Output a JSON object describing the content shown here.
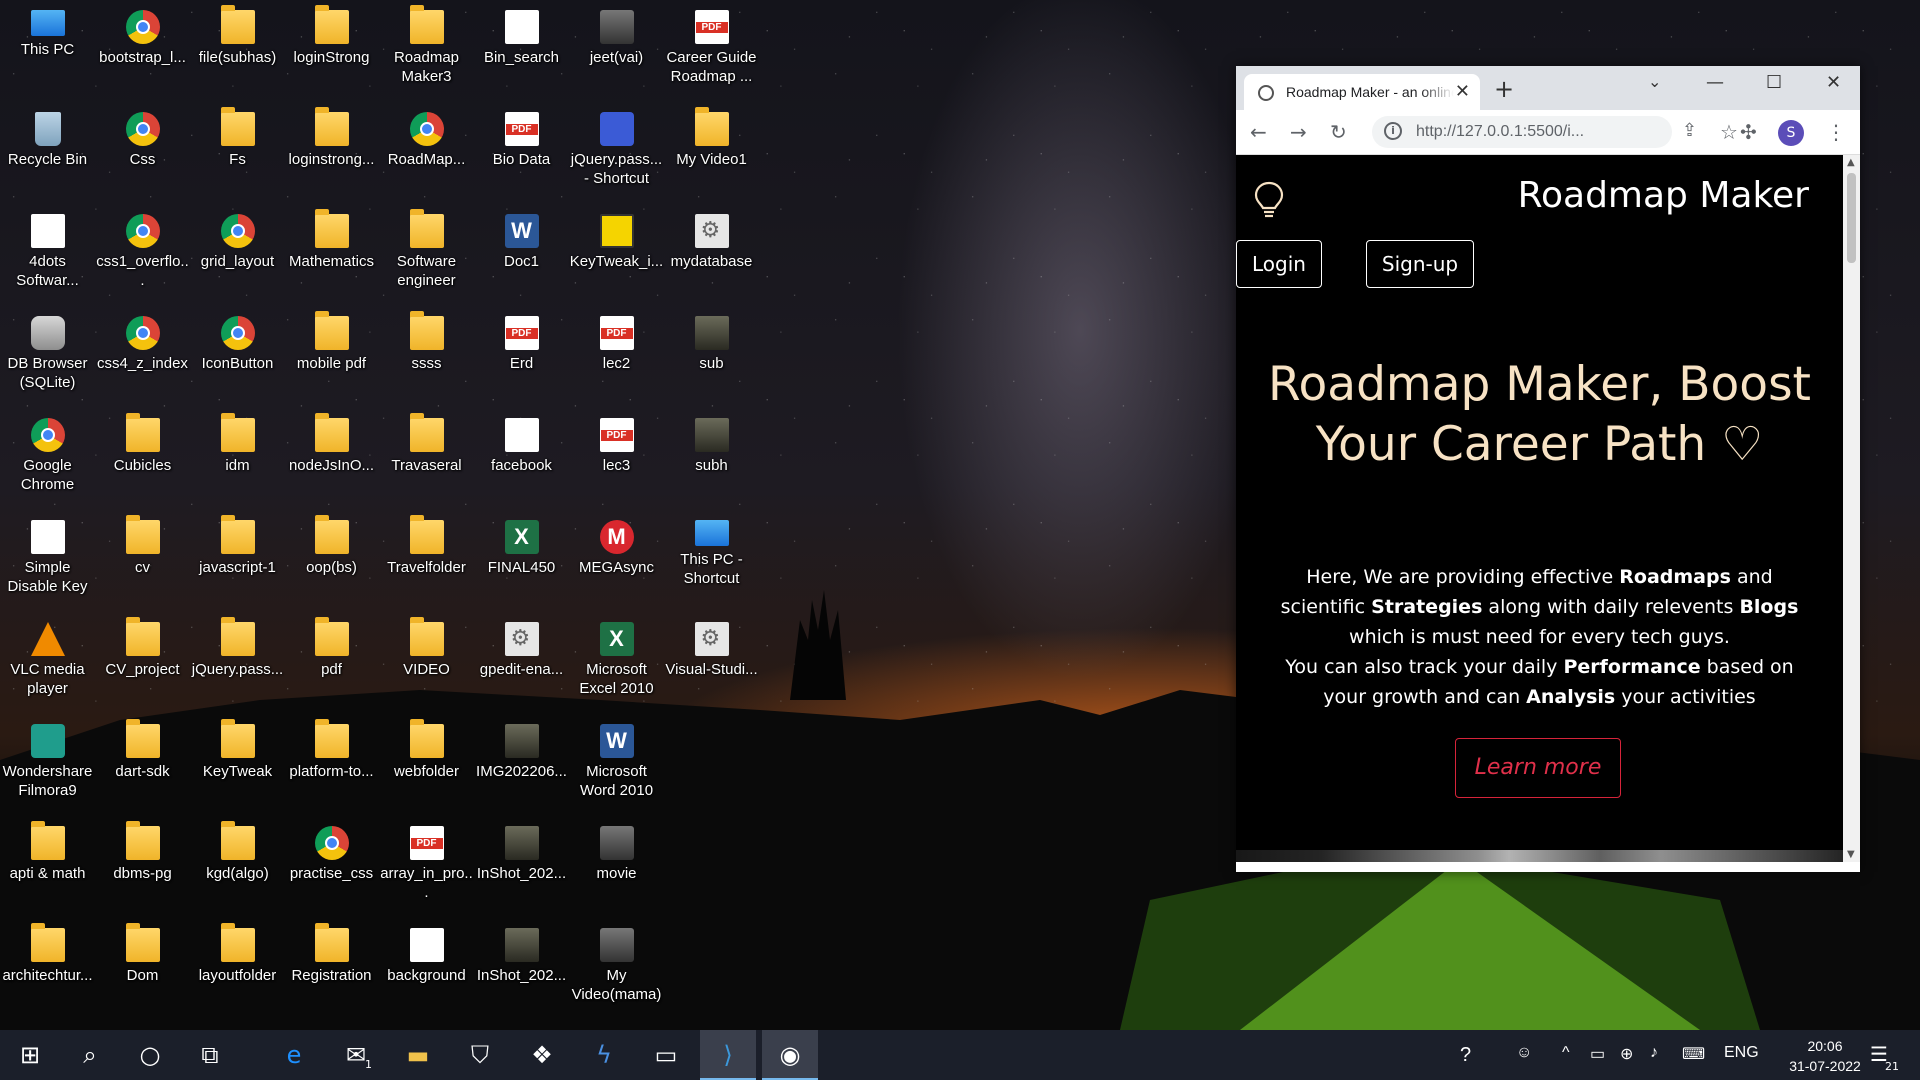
{
  "desktop": {
    "icons": [
      {
        "label": "This PC",
        "type": "pc"
      },
      {
        "label": "bootstrap_l...",
        "type": "chrome"
      },
      {
        "label": "file(subhas)",
        "type": "folder"
      },
      {
        "label": "loginStrong",
        "type": "folder"
      },
      {
        "label": "Roadmap Maker3",
        "type": "folder"
      },
      {
        "label": "Bin_search",
        "type": "doc"
      },
      {
        "label": "jeet(vai)",
        "type": "video"
      },
      {
        "label": "Career Guide Roadmap ...",
        "type": "pdf"
      },
      {
        "label": "Recycle Bin",
        "type": "bin"
      },
      {
        "label": "Css",
        "type": "chrome"
      },
      {
        "label": "Fs",
        "type": "folder"
      },
      {
        "label": "loginstrong...",
        "type": "folder"
      },
      {
        "label": "RoadMap...",
        "type": "chrome"
      },
      {
        "label": "Bio Data",
        "type": "pdf"
      },
      {
        "label": "jQuery.pass... - Shortcut",
        "type": "purple"
      },
      {
        "label": "My Video1",
        "type": "folder"
      },
      {
        "label": "4dots Softwar...",
        "type": "doc"
      },
      {
        "label": "css1_overflo...",
        "type": "chrome"
      },
      {
        "label": "grid_layout",
        "type": "chrome"
      },
      {
        "label": "Mathematics",
        "type": "folder"
      },
      {
        "label": "Software engineer",
        "type": "folder"
      },
      {
        "label": "Doc1",
        "type": "word"
      },
      {
        "label": "KeyTweak_i...",
        "type": "key"
      },
      {
        "label": "mydatabase",
        "type": "gear"
      },
      {
        "label": "DB Browser (SQLite)",
        "type": "db"
      },
      {
        "label": "css4_z_index",
        "type": "chrome"
      },
      {
        "label": "IconButton",
        "type": "chrome"
      },
      {
        "label": "mobile pdf",
        "type": "folder"
      },
      {
        "label": "ssss",
        "type": "folder"
      },
      {
        "label": "Erd",
        "type": "pdf"
      },
      {
        "label": "lec2",
        "type": "pdf"
      },
      {
        "label": "sub",
        "type": "photo"
      },
      {
        "label": "Google Chrome",
        "type": "chrome"
      },
      {
        "label": "Cubicles",
        "type": "folder"
      },
      {
        "label": "idm",
        "type": "folder"
      },
      {
        "label": "nodeJsInO...",
        "type": "folder"
      },
      {
        "label": "Travaseral",
        "type": "folder"
      },
      {
        "label": "facebook",
        "type": "doc"
      },
      {
        "label": "lec3",
        "type": "pdf"
      },
      {
        "label": "subh",
        "type": "photo"
      },
      {
        "label": "Simple Disable Key",
        "type": "doc"
      },
      {
        "label": "cv",
        "type": "folder"
      },
      {
        "label": "javascript-1",
        "type": "folder"
      },
      {
        "label": "oop(bs)",
        "type": "folder"
      },
      {
        "label": "Travelfolder",
        "type": "folder"
      },
      {
        "label": "FINAL450",
        "type": "excel"
      },
      {
        "label": "MEGAsync",
        "type": "mega"
      },
      {
        "label": "This PC - Shortcut",
        "type": "pc"
      },
      {
        "label": "VLC media player",
        "type": "vlc"
      },
      {
        "label": "CV_project",
        "type": "folder"
      },
      {
        "label": "jQuery.pass...",
        "type": "folder"
      },
      {
        "label": "pdf",
        "type": "folder"
      },
      {
        "label": "VIDEO",
        "type": "folder"
      },
      {
        "label": "gpedit-ena...",
        "type": "gear"
      },
      {
        "label": "Microsoft Excel 2010",
        "type": "excel"
      },
      {
        "label": "Visual-Studi...",
        "type": "gear"
      },
      {
        "label": "Wondershare Filmora9",
        "type": "wond"
      },
      {
        "label": "dart-sdk",
        "type": "folder"
      },
      {
        "label": "KeyTweak",
        "type": "folder"
      },
      {
        "label": "platform-to...",
        "type": "folder"
      },
      {
        "label": "webfolder",
        "type": "folder"
      },
      {
        "label": "IMG202206...",
        "type": "photo"
      },
      {
        "label": "Microsoft Word 2010",
        "type": "word"
      },
      {
        "label": "",
        "type": "none"
      },
      {
        "label": "apti & math",
        "type": "folder"
      },
      {
        "label": "dbms-pg",
        "type": "folder"
      },
      {
        "label": "kgd(algo)",
        "type": "folder"
      },
      {
        "label": "practise_css",
        "type": "chrome"
      },
      {
        "label": "array_in_pro...",
        "type": "pdf"
      },
      {
        "label": "InShot_202...",
        "type": "photo"
      },
      {
        "label": "movie",
        "type": "video"
      },
      {
        "label": "",
        "type": "none"
      },
      {
        "label": "architechtur...",
        "type": "folder"
      },
      {
        "label": "Dom",
        "type": "folder"
      },
      {
        "label": "layoutfolder",
        "type": "folder"
      },
      {
        "label": "Registration",
        "type": "folder"
      },
      {
        "label": "background",
        "type": "doc"
      },
      {
        "label": "InShot_202...",
        "type": "photo"
      },
      {
        "label": "My Video(mama)",
        "type": "video"
      },
      {
        "label": "",
        "type": "none"
      }
    ]
  },
  "browser": {
    "tab_title": "Roadmap Maker - an online c",
    "url": "http://127.0.0.1:5500/i...",
    "profile_initial": "S",
    "page": {
      "brand": "Roadmap Maker",
      "login": "Login",
      "signup": "Sign-up",
      "hero": "Roadmap Maker, Boost Your Career Path ♡",
      "p1": {
        "a": "Here, We are providing effective ",
        "b": "Roadmaps",
        "c": " and scientific ",
        "d": "Strategies",
        "e": " along with daily relevents ",
        "f": "Blogs",
        "g": " which is must need for every tech guys."
      },
      "p2": {
        "a": "You can also track your daily ",
        "b": "Performance",
        "c": " based on your growth and can ",
        "d": "Analysis",
        "e": " your activities"
      },
      "learn_more": "Learn more"
    }
  },
  "taskbar": {
    "language": "ENG",
    "time": "20:06",
    "date": "31-07-2022",
    "notification_count": "21",
    "mail_badge": "1"
  }
}
